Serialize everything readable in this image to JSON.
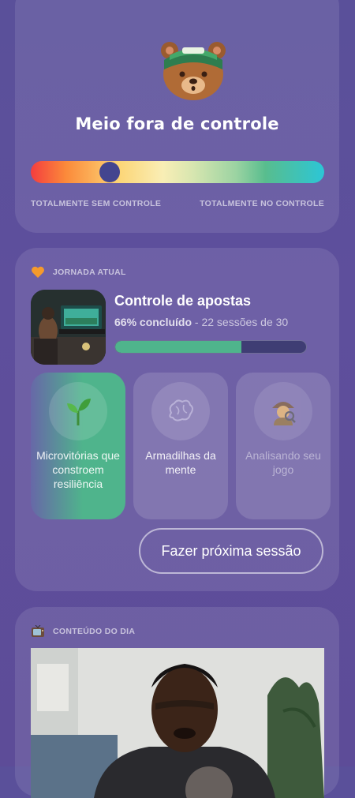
{
  "mood": {
    "icon": "bear-with-headband-icon",
    "title": "Meio fora de controle",
    "slider_value_percent": 27,
    "label_left": "TOTALMENTE SEM CONTROLE",
    "label_right": "TOTALMENTE NO CONTROLE"
  },
  "journey": {
    "section_icon": "orange-heart-icon",
    "section_label": "JORNADA ATUAL",
    "title": "Controle de apostas",
    "percent_text": "66% concluído",
    "sessions_text": " - 22 sessões de 30",
    "progress_percent": 66,
    "sessions": [
      {
        "icon": "seedling-icon",
        "label": "Microvitórias que constroem resiliência"
      },
      {
        "icon": "brain-icon",
        "label": "Armadilhas da mente"
      },
      {
        "icon": "detective-icon",
        "label": "Analisando seu jogo"
      }
    ],
    "next_button": "Fazer próxima sessão"
  },
  "content": {
    "section_icon": "tv-icon",
    "section_label": "CONTEÚDO DO DIA"
  },
  "colors": {
    "accent_green": "#4fb48c",
    "slider_thumb": "#43458f",
    "background": "#5a509a"
  }
}
